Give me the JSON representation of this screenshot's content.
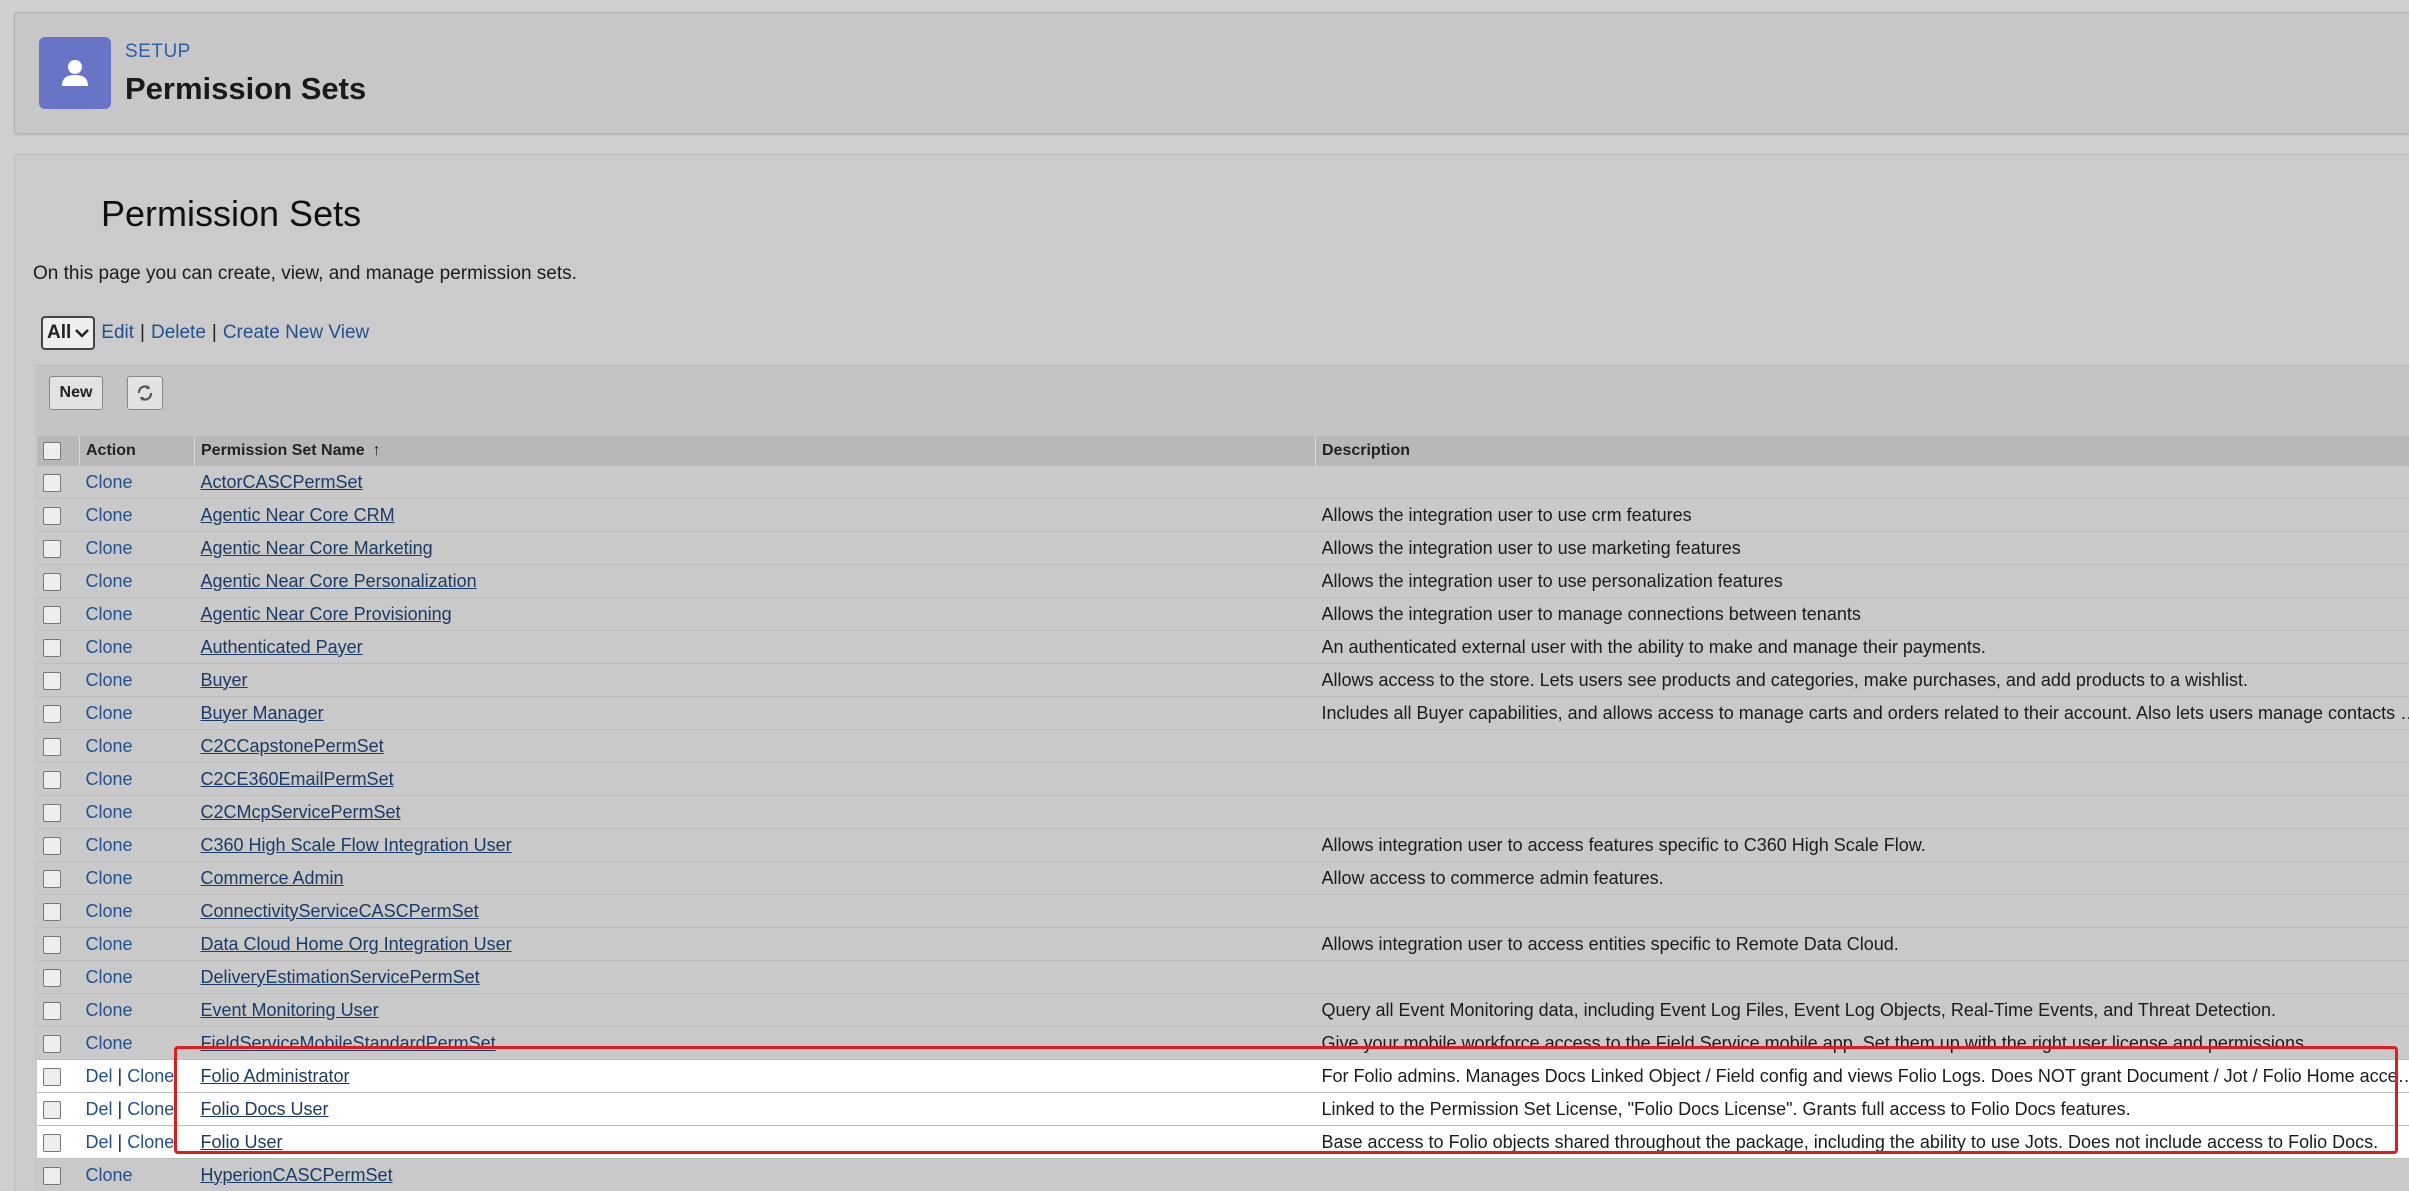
{
  "header": {
    "section_label": "SETUP",
    "title": "Permission Sets"
  },
  "page": {
    "heading": "Permission Sets",
    "description": "On this page you can create, view, and manage permission sets."
  },
  "views": {
    "selected": "All",
    "edit_label": "Edit",
    "delete_label": "Delete",
    "create_label": "Create New View"
  },
  "toolbar": {
    "new_label": "New"
  },
  "table": {
    "columns": {
      "action": "Action",
      "name": "Permission Set Name",
      "description": "Description"
    },
    "rows": [
      {
        "actions": [
          "Clone"
        ],
        "name": "ActorCASCPermSet",
        "description": ""
      },
      {
        "actions": [
          "Clone"
        ],
        "name": "Agentic Near Core CRM",
        "description": "Allows the integration user to use crm features"
      },
      {
        "actions": [
          "Clone"
        ],
        "name": "Agentic Near Core Marketing",
        "description": "Allows the integration user to use marketing features"
      },
      {
        "actions": [
          "Clone"
        ],
        "name": "Agentic Near Core Personalization",
        "description": "Allows the integration user to use personalization features"
      },
      {
        "actions": [
          "Clone"
        ],
        "name": "Agentic Near Core Provisioning",
        "description": "Allows the integration user to manage connections between tenants"
      },
      {
        "actions": [
          "Clone"
        ],
        "name": "Authenticated Payer",
        "description": "An authenticated external user with the ability to make and manage their payments."
      },
      {
        "actions": [
          "Clone"
        ],
        "name": "Buyer",
        "description": "Allows access to the store. Lets users see products and categories, make purchases, and add products to a wishlist."
      },
      {
        "actions": [
          "Clone"
        ],
        "name": "Buyer Manager",
        "description": "Includes all Buyer capabilities, and allows access to manage carts and orders related to their account. Also lets users manage contacts an…"
      },
      {
        "actions": [
          "Clone"
        ],
        "name": "C2CCapstonePermSet",
        "description": ""
      },
      {
        "actions": [
          "Clone"
        ],
        "name": "C2CE360EmailPermSet",
        "description": ""
      },
      {
        "actions": [
          "Clone"
        ],
        "name": "C2CMcpServicePermSet",
        "description": ""
      },
      {
        "actions": [
          "Clone"
        ],
        "name": "C360 High Scale Flow Integration User",
        "description": "Allows integration user to access features specific to C360 High Scale Flow."
      },
      {
        "actions": [
          "Clone"
        ],
        "name": "Commerce Admin",
        "description": "Allow access to commerce admin features."
      },
      {
        "actions": [
          "Clone"
        ],
        "name": "ConnectivityServiceCASCPermSet",
        "description": ""
      },
      {
        "actions": [
          "Clone"
        ],
        "name": "Data Cloud Home Org Integration User",
        "description": "Allows integration user to access entities specific to Remote Data Cloud."
      },
      {
        "actions": [
          "Clone"
        ],
        "name": "DeliveryEstimationServicePermSet",
        "description": ""
      },
      {
        "actions": [
          "Clone"
        ],
        "name": "Event Monitoring User",
        "description": "Query all Event Monitoring data, including Event Log Files, Event Log Objects, Real-Time Events, and Threat Detection."
      },
      {
        "actions": [
          "Clone"
        ],
        "name": "FieldServiceMobileStandardPermSet",
        "description": "Give your mobile workforce access to the Field Service mobile app. Set them up with the right user license and permissions."
      },
      {
        "actions": [
          "Del",
          "Clone"
        ],
        "name": "Folio Administrator",
        "description": "For Folio admins. Manages Docs Linked Object / Field config and views Folio Logs. Does NOT grant Document / Jot / Folio Home access …"
      },
      {
        "actions": [
          "Del",
          "Clone"
        ],
        "name": "Folio Docs User",
        "description": "Linked to the Permission Set License, \"Folio Docs License\". Grants full access to Folio Docs features."
      },
      {
        "actions": [
          "Del",
          "Clone"
        ],
        "name": "Folio User",
        "description": "Base access to Folio objects shared throughout the package, including the ability to use Jots. Does not include access to Folio Docs."
      },
      {
        "actions": [
          "Clone"
        ],
        "name": "HyperionCASCPermSet",
        "description": ""
      }
    ]
  },
  "colors": {
    "highlight_border": "#e21c1c",
    "link": "#23508f",
    "setup_icon_bg": "#6a74c6"
  },
  "icons": [
    "user-icon",
    "refresh-icon",
    "chevron-down-icon",
    "sort-up-icon"
  ]
}
